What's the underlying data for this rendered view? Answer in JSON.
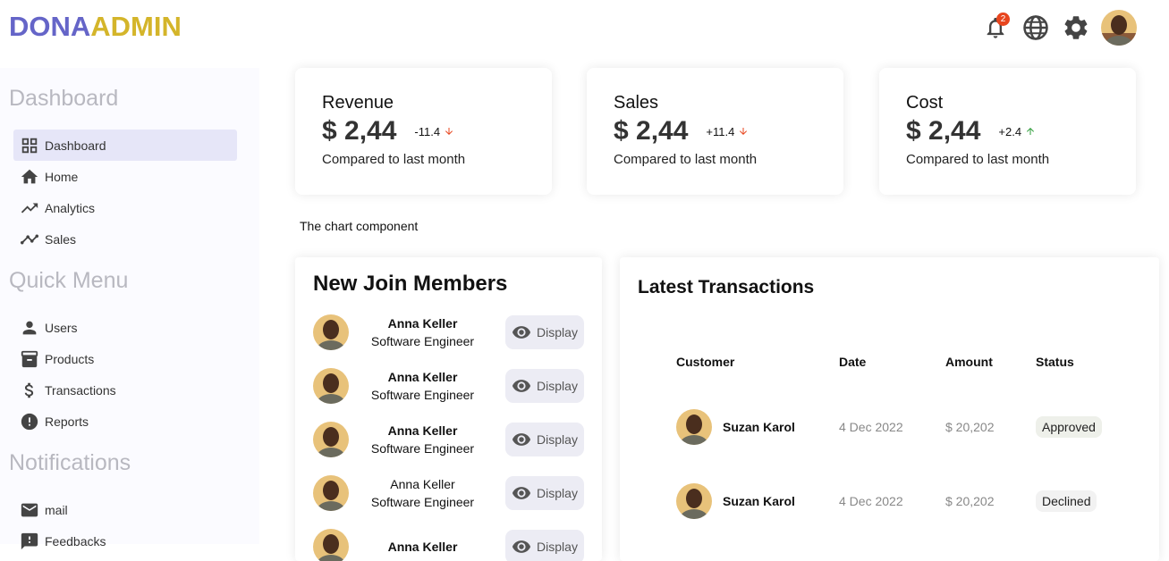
{
  "brand": {
    "part1": "DONA",
    "part2": "ADMIN"
  },
  "topbar": {
    "notification_count": "2"
  },
  "sidebar": {
    "sections": [
      {
        "title": "Dashboard"
      },
      {
        "title": "Quick Menu"
      },
      {
        "title": "Notifications"
      }
    ],
    "items": [
      {
        "label": "Dashboard",
        "icon": "grid-icon",
        "active": true
      },
      {
        "label": "Home",
        "icon": "home-icon"
      },
      {
        "label": "Analytics",
        "icon": "trending-up-icon"
      },
      {
        "label": "Sales",
        "icon": "timeline-icon"
      },
      {
        "label": "Users",
        "icon": "person-icon"
      },
      {
        "label": "Products",
        "icon": "archive-icon"
      },
      {
        "label": "Transactions",
        "icon": "dollar-icon"
      },
      {
        "label": "Reports",
        "icon": "alert-icon"
      },
      {
        "label": "mail",
        "icon": "mail-icon"
      },
      {
        "label": "Feedbacks",
        "icon": "feedback-icon"
      }
    ]
  },
  "cards": [
    {
      "title": "Revenue",
      "amount": "$ 2,44",
      "rate": "-11.4",
      "trend": "down",
      "compare": "Compared to last month"
    },
    {
      "title": "Sales",
      "amount": "$ 2,44",
      "rate": "+11.4",
      "trend": "down",
      "compare": "Compared to last month"
    },
    {
      "title": "Cost",
      "amount": "$ 2,44",
      "rate": "+2.4",
      "trend": "up",
      "compare": "Compared to last month"
    }
  ],
  "chart_placeholder": "The chart component",
  "members": {
    "title": "New Join Members",
    "button_label": "Display",
    "list": [
      {
        "name": "Anna Keller",
        "role": "Software Engineer"
      },
      {
        "name": "Anna Keller",
        "role": "Software Engineer"
      },
      {
        "name": "Anna Keller",
        "role": "Software Engineer"
      },
      {
        "name": "Anna Keller",
        "role": "Software Engineer"
      },
      {
        "name": "Anna Keller",
        "role": ""
      }
    ]
  },
  "transactions": {
    "title": "Latest Transactions",
    "headers": {
      "customer": "Customer",
      "date": "Date",
      "amount": "Amount",
      "status": "Status"
    },
    "rows": [
      {
        "customer": "Suzan Karol",
        "date": "4 Dec 2022",
        "amount": "$ 20,202",
        "status": "Approved"
      },
      {
        "customer": "Suzan Karol",
        "date": "4 Dec 2022",
        "amount": "$ 20,202",
        "status": "Declined"
      }
    ]
  },
  "colors": {
    "brand_primary": "#6565c8",
    "brand_secondary": "#d4b52a",
    "trend_down": "#e8451e",
    "trend_up": "#2e9d3a"
  }
}
